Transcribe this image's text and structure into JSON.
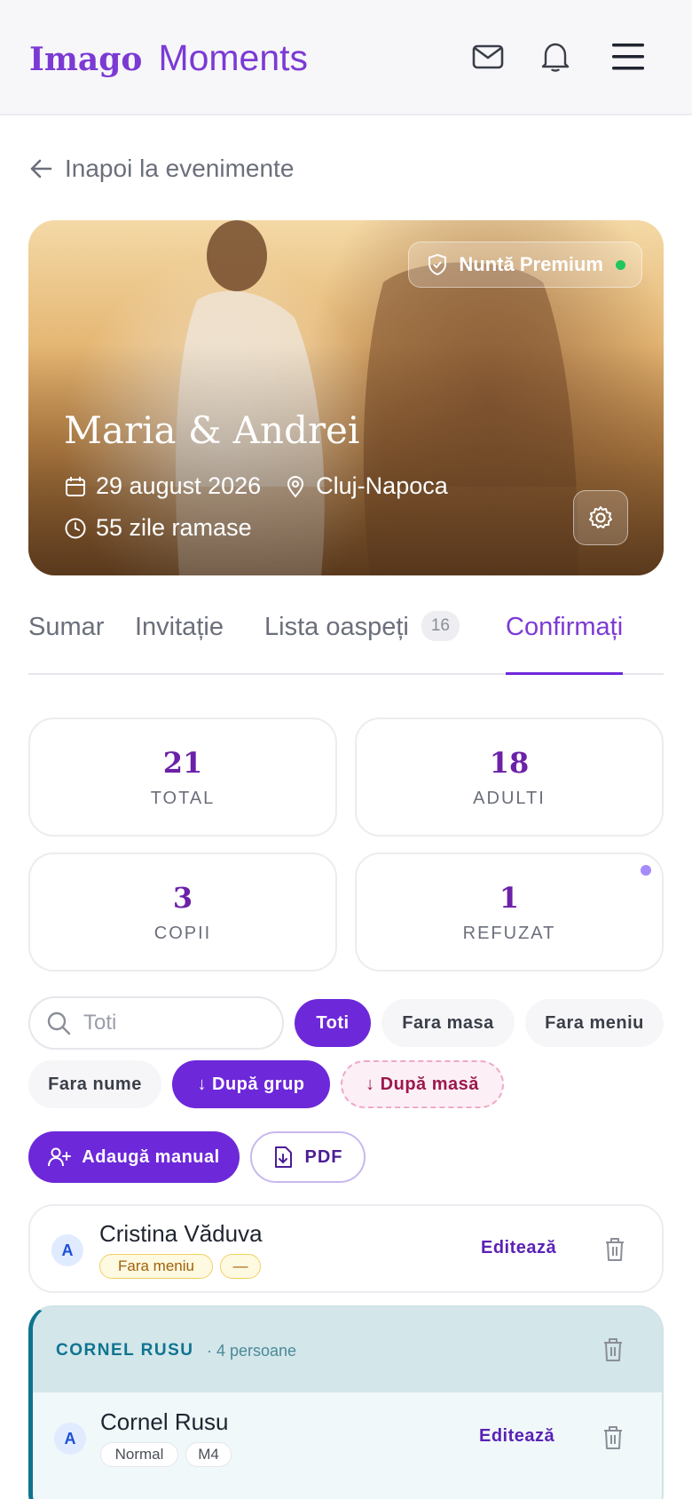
{
  "header": {
    "logo_part1": "Imago",
    "logo_part2": "Moments"
  },
  "back_link": "Inapoi la evenimente",
  "event": {
    "plan_badge": "Nuntă Premium",
    "couple": "Maria & Andrei",
    "date": "29 august 2026",
    "location": "Cluj-Napoca",
    "countdown": "55 zile ramase"
  },
  "tabs": [
    {
      "label": "Sumar"
    },
    {
      "label": "Invitație"
    },
    {
      "label": "Lista oaspeți",
      "count": "16"
    },
    {
      "label": "Confirmați",
      "active": true
    }
  ],
  "stats": [
    {
      "value": "21",
      "label": "TOTAL"
    },
    {
      "value": "18",
      "label": "ADULTI"
    },
    {
      "value": "3",
      "label": "COPII"
    },
    {
      "value": "1",
      "label": "REFUZAT"
    }
  ],
  "search": {
    "placeholder": "Toti"
  },
  "filters": [
    {
      "label": "Toti",
      "active": true
    },
    {
      "label": "Fara masa"
    },
    {
      "label": "Fara meniu"
    },
    {
      "label": "Fara nume"
    },
    {
      "label": "↓ După grup",
      "active": true
    },
    {
      "label": "↓ După masă"
    }
  ],
  "actions": {
    "add": "Adaugă manual",
    "pdf": "PDF"
  },
  "guests": [
    {
      "initial": "A",
      "name": "Cristina Văduva",
      "tags": [
        "Fara meniu",
        "—"
      ],
      "edit": "Editează"
    }
  ],
  "group": {
    "title": "CORNEL RUSU",
    "count": "· 4 persoane",
    "members": [
      {
        "initial": "A",
        "name": "Cornel Rusu",
        "tags": [
          "Normal",
          "M4"
        ],
        "edit": "Editează"
      }
    ]
  },
  "colors": {
    "accent": "#6d28d9",
    "group_accent": "#0e7490",
    "status_dot": "#22c55e"
  }
}
